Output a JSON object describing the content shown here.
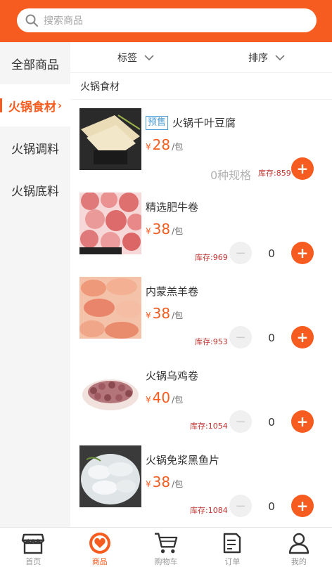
{
  "search": {
    "placeholder": "搜索商品"
  },
  "sidebar": {
    "items": [
      {
        "label": "全部商品"
      },
      {
        "label": "火锅食材"
      },
      {
        "label": "火锅调料"
      },
      {
        "label": "火锅底料"
      }
    ]
  },
  "filters": {
    "tag_label": "标签",
    "sort_label": "排序"
  },
  "section": {
    "title": "火锅食材"
  },
  "products": [
    {
      "tag": "预售",
      "name": "火锅千叶豆腐",
      "price": "28",
      "unit": "/包",
      "stock": "库存:859",
      "specs": "0种规格",
      "currency": "¥"
    },
    {
      "name": "精选肥牛卷",
      "price": "38",
      "unit": "/包",
      "stock": "库存:969",
      "qty": "0",
      "currency": "¥"
    },
    {
      "name": "内蒙羔羊卷",
      "price": "38",
      "unit": "/包",
      "stock": "库存:953",
      "qty": "0",
      "currency": "¥"
    },
    {
      "name": "火锅乌鸡卷",
      "price": "40",
      "unit": "/包",
      "stock": "库存:1054",
      "qty": "0",
      "currency": "¥"
    },
    {
      "name": "火锅免浆黑鱼片",
      "price": "38",
      "unit": "/包",
      "stock": "库存:1084",
      "qty": "0",
      "currency": "¥"
    }
  ],
  "tabbar": {
    "items": [
      {
        "label": "首页",
        "icon": "shop-icon"
      },
      {
        "label": "商品",
        "icon": "goods-icon"
      },
      {
        "label": "购物车",
        "icon": "cart-icon"
      },
      {
        "label": "订单",
        "icon": "order-icon"
      },
      {
        "label": "我的",
        "icon": "user-icon"
      }
    ]
  },
  "colors": {
    "brand": "#f65c1f",
    "stock": "#c0322f",
    "tag": "#4b9cd6"
  }
}
